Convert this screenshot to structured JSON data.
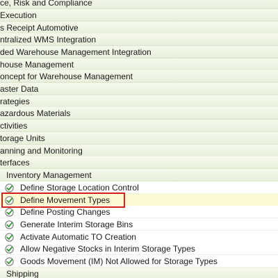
{
  "tree": {
    "rows": [
      {
        "label": "ce, Risk and Compliance",
        "kind": "node",
        "indent": 0,
        "icon": ""
      },
      {
        "label": "Execution",
        "kind": "node",
        "indent": 0,
        "icon": ""
      },
      {
        "label": "s Receipt Automotive",
        "kind": "node",
        "indent": 0,
        "icon": ""
      },
      {
        "label": "ntralized WMS Integration",
        "kind": "node",
        "indent": 0,
        "icon": ""
      },
      {
        "label": "ded Warehouse Management Integration",
        "kind": "node",
        "indent": 0,
        "icon": ""
      },
      {
        "label": "house Management",
        "kind": "node",
        "indent": 0,
        "icon": ""
      },
      {
        "label": "oncept for Warehouse Management",
        "kind": "node",
        "indent": 0,
        "icon": ""
      },
      {
        "label": "aster Data",
        "kind": "node",
        "indent": 0,
        "icon": ""
      },
      {
        "label": "rategies",
        "kind": "node",
        "indent": 0,
        "icon": ""
      },
      {
        "label": "azardous Materials",
        "kind": "node",
        "indent": 0,
        "icon": ""
      },
      {
        "label": "ctivities",
        "kind": "node",
        "indent": 0,
        "icon": ""
      },
      {
        "label": "torage Units",
        "kind": "node",
        "indent": 0,
        "icon": ""
      },
      {
        "label": "anning and Monitoring",
        "kind": "node",
        "indent": 0,
        "icon": ""
      },
      {
        "label": "terfaces",
        "kind": "node",
        "indent": 0,
        "icon": ""
      },
      {
        "label": "Inventory Management",
        "kind": "node",
        "indent": 1,
        "icon": ""
      },
      {
        "label": "Define Storage Location Control",
        "kind": "leaf",
        "indent": 2,
        "icon": "execute-activity-icon"
      },
      {
        "label": "Define Movement Types",
        "kind": "leaf",
        "indent": 2,
        "icon": "execute-activity-icon",
        "highlight": true
      },
      {
        "label": "Define Posting Changes",
        "kind": "leaf",
        "indent": 2,
        "icon": "execute-activity-icon"
      },
      {
        "label": "Generate Interim Storage Bins",
        "kind": "leaf",
        "indent": 2,
        "icon": "execute-activity-icon"
      },
      {
        "label": "Activate Automatic TO Creation",
        "kind": "leaf",
        "indent": 2,
        "icon": "execute-activity-icon"
      },
      {
        "label": "Allow Negative Stocks in Interim Storage Types",
        "kind": "leaf",
        "indent": 2,
        "icon": "execute-activity-icon"
      },
      {
        "label": "Goods Movement (IM) Not Allowed for Storage Types",
        "kind": "leaf",
        "indent": 2,
        "icon": "execute-activity-icon"
      },
      {
        "label": "Shipping",
        "kind": "node",
        "indent": 1,
        "icon": ""
      }
    ]
  },
  "colors": {
    "node_bg": "#e8f0dc",
    "highlight_bg": "#fbf9d2",
    "selection_border": "#d4201b",
    "icon_green": "#2e9a2e"
  }
}
